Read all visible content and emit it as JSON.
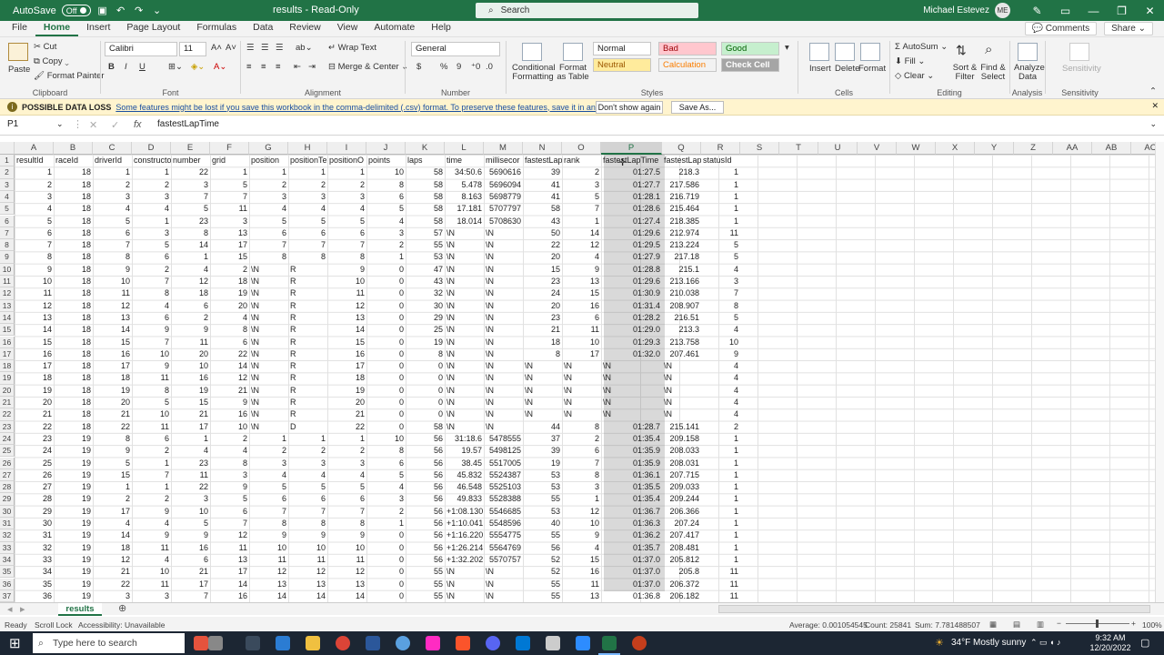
{
  "title_bar": {
    "autosave_label": "AutoSave",
    "autosave_state": "Off",
    "file_title": "results - Read-Only",
    "search_placeholder": "Search",
    "user_name": "Michael Estevez",
    "user_initials": "ME"
  },
  "menu": {
    "tabs": [
      "File",
      "Home",
      "Insert",
      "Page Layout",
      "Formulas",
      "Data",
      "Review",
      "View",
      "Automate",
      "Help"
    ],
    "comments": "Comments",
    "share": "Share"
  },
  "ribbon": {
    "clipboard": {
      "paste": "Paste",
      "cut": "Cut",
      "copy": "Copy",
      "format_painter": "Format Painter",
      "label": "Clipboard"
    },
    "font": {
      "name": "Calibri",
      "size": "11",
      "label": "Font",
      "bold": "B",
      "italic": "I",
      "underline": "U"
    },
    "alignment": {
      "wrap": "Wrap Text",
      "merge": "Merge & Center",
      "label": "Alignment"
    },
    "number": {
      "format": "General",
      "label": "Number",
      "currency": "$",
      "percent": "%",
      "comma": "9"
    },
    "styles": {
      "conditional": "Conditional Formatting",
      "format_table": "Format as Table",
      "normal": "Normal",
      "bad": "Bad",
      "good": "Good",
      "neutral": "Neutral",
      "calculation": "Calculation",
      "check_cell": "Check Cell",
      "label": "Styles"
    },
    "cells": {
      "insert": "Insert",
      "delete": "Delete",
      "format": "Format",
      "label": "Cells"
    },
    "editing": {
      "autosum": "AutoSum",
      "fill": "Fill",
      "clear": "Clear",
      "sort": "Sort & Filter",
      "find": "Find & Select",
      "label": "Editing"
    },
    "analysis": {
      "analyze": "Analyze Data",
      "label": "Analysis"
    },
    "sensitivity": {
      "sensitivity": "Sensitivity",
      "label": "Sensitivity"
    }
  },
  "info_bar": {
    "title": "POSSIBLE DATA LOSS",
    "message": "Some features might be lost if you save this workbook in the comma-delimited (.csv) format. To preserve these features, save it in an Excel file format.",
    "dont_show": "Don't show again",
    "save_as": "Save As..."
  },
  "formula_bar": {
    "name_box": "P1",
    "fx": "fx",
    "content": "fastestLapTime"
  },
  "sheet": {
    "columns": [
      "A",
      "B",
      "C",
      "D",
      "E",
      "F",
      "G",
      "H",
      "I",
      "J",
      "K",
      "L",
      "M",
      "N",
      "O",
      "P",
      "Q",
      "R",
      "S",
      "T",
      "U",
      "V",
      "W",
      "X",
      "Y",
      "Z",
      "AA",
      "AB",
      "AC"
    ],
    "selected_column": "P",
    "row_numbers": [
      "1",
      "2",
      "3",
      "4",
      "5",
      "6",
      "7",
      "8",
      "9",
      "10",
      "11",
      "12",
      "13",
      "14",
      "15",
      "16",
      "17",
      "18",
      "19",
      "20",
      "21",
      "22",
      "23",
      "24",
      "25",
      "26",
      "27",
      "28",
      "29",
      "30",
      "31",
      "32",
      "33",
      "34",
      "35",
      "36",
      "37"
    ],
    "rows": [
      [
        "resultId",
        "raceId",
        "driverId",
        "constructo",
        "number",
        "grid",
        "position",
        "positionTe",
        "positionO",
        "points",
        "laps",
        "time",
        "millisecor",
        "fastestLap",
        "rank",
        "fastestLapTime",
        "fastestLap",
        "statusId"
      ],
      [
        "1",
        "18",
        "1",
        "1",
        "22",
        "1",
        "1",
        "1",
        "1",
        "10",
        "58",
        "34:50.6",
        "5690616",
        "39",
        "2",
        "01:27.5",
        "218.3",
        "1"
      ],
      [
        "2",
        "18",
        "2",
        "2",
        "3",
        "5",
        "2",
        "2",
        "2",
        "8",
        "58",
        "5.478",
        "5696094",
        "41",
        "3",
        "01:27.7",
        "217.586",
        "1"
      ],
      [
        "3",
        "18",
        "3",
        "3",
        "7",
        "7",
        "3",
        "3",
        "3",
        "6",
        "58",
        "8.163",
        "5698779",
        "41",
        "5",
        "01:28.1",
        "216.719",
        "1"
      ],
      [
        "4",
        "18",
        "4",
        "4",
        "5",
        "11",
        "4",
        "4",
        "4",
        "5",
        "58",
        "17.181",
        "5707797",
        "58",
        "7",
        "01:28.6",
        "215.464",
        "1"
      ],
      [
        "5",
        "18",
        "5",
        "1",
        "23",
        "3",
        "5",
        "5",
        "5",
        "4",
        "58",
        "18.014",
        "5708630",
        "43",
        "1",
        "01:27.4",
        "218.385",
        "1"
      ],
      [
        "6",
        "18",
        "6",
        "3",
        "8",
        "13",
        "6",
        "6",
        "6",
        "3",
        "57",
        "\\N",
        "\\N",
        "50",
        "14",
        "01:29.6",
        "212.974",
        "11"
      ],
      [
        "7",
        "18",
        "7",
        "5",
        "14",
        "17",
        "7",
        "7",
        "7",
        "2",
        "55",
        "\\N",
        "\\N",
        "22",
        "12",
        "01:29.5",
        "213.224",
        "5"
      ],
      [
        "8",
        "18",
        "8",
        "6",
        "1",
        "15",
        "8",
        "8",
        "8",
        "1",
        "53",
        "\\N",
        "\\N",
        "20",
        "4",
        "01:27.9",
        "217.18",
        "5"
      ],
      [
        "9",
        "18",
        "9",
        "2",
        "4",
        "2",
        "\\N",
        "R",
        "9",
        "0",
        "47",
        "\\N",
        "\\N",
        "15",
        "9",
        "01:28.8",
        "215.1",
        "4"
      ],
      [
        "10",
        "18",
        "10",
        "7",
        "12",
        "18",
        "\\N",
        "R",
        "10",
        "0",
        "43",
        "\\N",
        "\\N",
        "23",
        "13",
        "01:29.6",
        "213.166",
        "3"
      ],
      [
        "11",
        "18",
        "11",
        "8",
        "18",
        "19",
        "\\N",
        "R",
        "11",
        "0",
        "32",
        "\\N",
        "\\N",
        "24",
        "15",
        "01:30.9",
        "210.038",
        "7"
      ],
      [
        "12",
        "18",
        "12",
        "4",
        "6",
        "20",
        "\\N",
        "R",
        "12",
        "0",
        "30",
        "\\N",
        "\\N",
        "20",
        "16",
        "01:31.4",
        "208.907",
        "8"
      ],
      [
        "13",
        "18",
        "13",
        "6",
        "2",
        "4",
        "\\N",
        "R",
        "13",
        "0",
        "29",
        "\\N",
        "\\N",
        "23",
        "6",
        "01:28.2",
        "216.51",
        "5"
      ],
      [
        "14",
        "18",
        "14",
        "9",
        "9",
        "8",
        "\\N",
        "R",
        "14",
        "0",
        "25",
        "\\N",
        "\\N",
        "21",
        "11",
        "01:29.0",
        "213.3",
        "4"
      ],
      [
        "15",
        "18",
        "15",
        "7",
        "11",
        "6",
        "\\N",
        "R",
        "15",
        "0",
        "19",
        "\\N",
        "\\N",
        "18",
        "10",
        "01:29.3",
        "213.758",
        "10"
      ],
      [
        "16",
        "18",
        "16",
        "10",
        "20",
        "22",
        "\\N",
        "R",
        "16",
        "0",
        "8",
        "\\N",
        "\\N",
        "8",
        "17",
        "01:32.0",
        "207.461",
        "9"
      ],
      [
        "17",
        "18",
        "17",
        "9",
        "10",
        "14",
        "\\N",
        "R",
        "17",
        "0",
        "0",
        "\\N",
        "\\N",
        "\\N",
        "\\N",
        "\\N",
        "\\N",
        "4"
      ],
      [
        "18",
        "18",
        "18",
        "11",
        "16",
        "12",
        "\\N",
        "R",
        "18",
        "0",
        "0",
        "\\N",
        "\\N",
        "\\N",
        "\\N",
        "\\N",
        "\\N",
        "4"
      ],
      [
        "19",
        "18",
        "19",
        "8",
        "19",
        "21",
        "\\N",
        "R",
        "19",
        "0",
        "0",
        "\\N",
        "\\N",
        "\\N",
        "\\N",
        "\\N",
        "\\N",
        "4"
      ],
      [
        "20",
        "18",
        "20",
        "5",
        "15",
        "9",
        "\\N",
        "R",
        "20",
        "0",
        "0",
        "\\N",
        "\\N",
        "\\N",
        "\\N",
        "\\N",
        "\\N",
        "4"
      ],
      [
        "21",
        "18",
        "21",
        "10",
        "21",
        "16",
        "\\N",
        "R",
        "21",
        "0",
        "0",
        "\\N",
        "\\N",
        "\\N",
        "\\N",
        "\\N",
        "\\N",
        "4"
      ],
      [
        "22",
        "18",
        "22",
        "11",
        "17",
        "10",
        "\\N",
        "D",
        "22",
        "0",
        "58",
        "\\N",
        "\\N",
        "44",
        "8",
        "01:28.7",
        "215.141",
        "2"
      ],
      [
        "23",
        "19",
        "8",
        "6",
        "1",
        "2",
        "1",
        "1",
        "1",
        "10",
        "56",
        "31:18.6",
        "5478555",
        "37",
        "2",
        "01:35.4",
        "209.158",
        "1"
      ],
      [
        "24",
        "19",
        "9",
        "2",
        "4",
        "4",
        "2",
        "2",
        "2",
        "8",
        "56",
        "19.57",
        "5498125",
        "39",
        "6",
        "01:35.9",
        "208.033",
        "1"
      ],
      [
        "25",
        "19",
        "5",
        "1",
        "23",
        "8",
        "3",
        "3",
        "3",
        "6",
        "56",
        "38.45",
        "5517005",
        "19",
        "7",
        "01:35.9",
        "208.031",
        "1"
      ],
      [
        "26",
        "19",
        "15",
        "7",
        "11",
        "3",
        "4",
        "4",
        "4",
        "5",
        "56",
        "45.832",
        "5524387",
        "53",
        "8",
        "01:36.1",
        "207.715",
        "1"
      ],
      [
        "27",
        "19",
        "1",
        "1",
        "22",
        "9",
        "5",
        "5",
        "5",
        "4",
        "56",
        "46.548",
        "5525103",
        "53",
        "3",
        "01:35.5",
        "209.033",
        "1"
      ],
      [
        "28",
        "19",
        "2",
        "2",
        "3",
        "5",
        "6",
        "6",
        "6",
        "3",
        "56",
        "49.833",
        "5528388",
        "55",
        "1",
        "01:35.4",
        "209.244",
        "1"
      ],
      [
        "29",
        "19",
        "17",
        "9",
        "10",
        "6",
        "7",
        "7",
        "7",
        "2",
        "56",
        "+1:08.130",
        "5546685",
        "53",
        "12",
        "01:36.7",
        "206.366",
        "1"
      ],
      [
        "30",
        "19",
        "4",
        "4",
        "5",
        "7",
        "8",
        "8",
        "8",
        "1",
        "56",
        "+1:10.041",
        "5548596",
        "40",
        "10",
        "01:36.3",
        "207.24",
        "1"
      ],
      [
        "31",
        "19",
        "14",
        "9",
        "9",
        "12",
        "9",
        "9",
        "9",
        "0",
        "56",
        "+1:16.220",
        "5554775",
        "55",
        "9",
        "01:36.2",
        "207.417",
        "1"
      ],
      [
        "32",
        "19",
        "18",
        "11",
        "16",
        "11",
        "10",
        "10",
        "10",
        "0",
        "56",
        "+1:26.214",
        "5564769",
        "56",
        "4",
        "01:35.7",
        "208.481",
        "1"
      ],
      [
        "33",
        "19",
        "12",
        "4",
        "6",
        "13",
        "11",
        "11",
        "11",
        "0",
        "56",
        "+1:32.202",
        "5570757",
        "52",
        "15",
        "01:37.0",
        "205.812",
        "1"
      ],
      [
        "34",
        "19",
        "21",
        "10",
        "21",
        "17",
        "12",
        "12",
        "12",
        "0",
        "55",
        "\\N",
        "\\N",
        "52",
        "16",
        "01:37.0",
        "205.8",
        "11"
      ],
      [
        "35",
        "19",
        "22",
        "11",
        "17",
        "14",
        "13",
        "13",
        "13",
        "0",
        "55",
        "\\N",
        "\\N",
        "55",
        "11",
        "01:37.0",
        "206.372",
        "11"
      ],
      [
        "36",
        "19",
        "3",
        "3",
        "7",
        "16",
        "14",
        "14",
        "14",
        "0",
        "55",
        "\\N",
        "\\N",
        "55",
        "13",
        "01:36.8",
        "206.182",
        "11"
      ]
    ],
    "tab": "results"
  },
  "status_bar": {
    "ready": "Ready",
    "scroll_lock": "Scroll Lock",
    "accessibility": "Accessibility: Unavailable",
    "average": "Average: 0.001054545",
    "count": "Count: 25841",
    "sum": "Sum: 7.781488507",
    "zoom": "100%"
  },
  "taskbar": {
    "search_placeholder": "Type here to search",
    "weather": "34°F  Mostly sunny",
    "time": "9:32 AM",
    "date": "12/20/2022"
  }
}
